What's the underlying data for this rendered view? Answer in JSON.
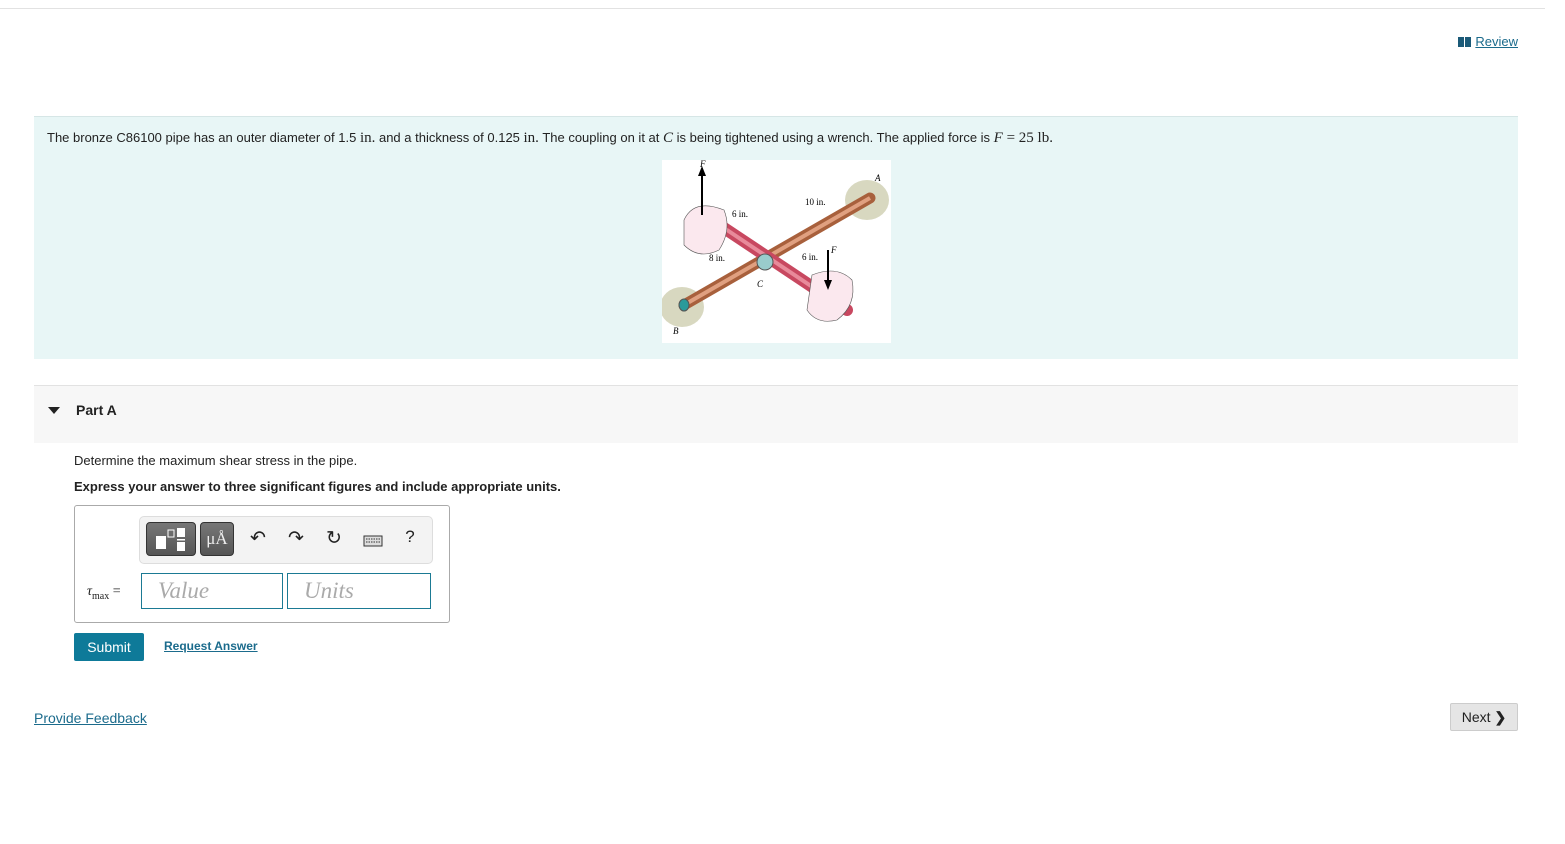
{
  "header": {
    "review_label": "Review",
    "review_icon": "book-icon"
  },
  "problem": {
    "text_1": "The bronze C86100 pipe has an outer diameter of 1.5 ",
    "unit_1": "in.",
    "text_2": " and a thickness of 0.125 ",
    "unit_2": "in.",
    "text_3": " The coupling on it at ",
    "point": "C",
    "text_4": " is being tightened using a wrench. The applied force is ",
    "force_var": "F",
    "force_eq": " = 25 lb.",
    "figure": {
      "labels": {
        "F_top": "F",
        "F_bottom": "F",
        "A": "A",
        "B": "B",
        "C": "C",
        "d10": "10 in.",
        "d6a": "6 in.",
        "d6b": "6 in.",
        "d8": "8 in."
      }
    }
  },
  "part": {
    "label": "Part A",
    "question": "Determine the maximum shear stress in the pipe.",
    "instruction": "Express your answer to three significant figures and include appropriate units.",
    "var_symbol": "τ",
    "var_sub": "max",
    "equals": " =",
    "value_placeholder": "Value",
    "units_placeholder": "Units",
    "toolbar": {
      "units_btn": "μÅ",
      "help": "?"
    },
    "submit_label": "Submit",
    "request_answer_label": "Request Answer"
  },
  "footer": {
    "feedback_label": "Provide Feedback",
    "next_label": "Next"
  }
}
